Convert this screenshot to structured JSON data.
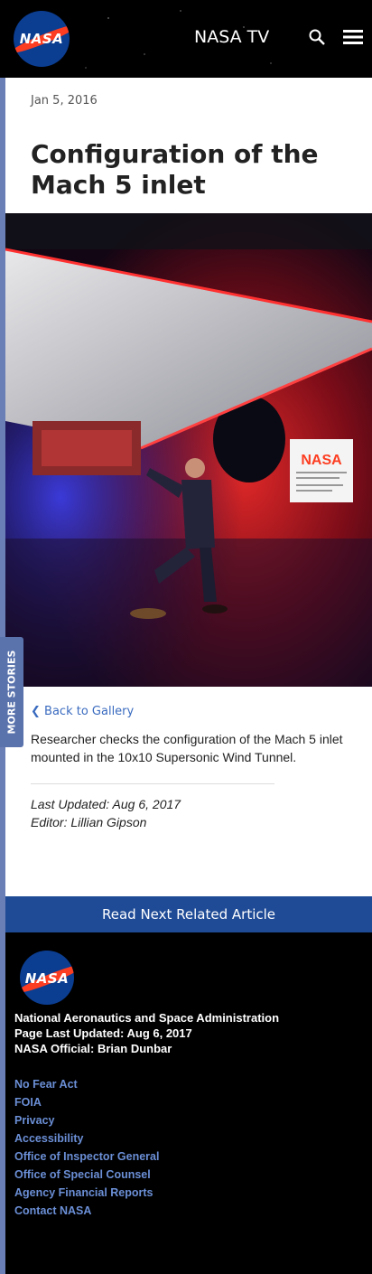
{
  "header": {
    "logo_text": "NASA",
    "nav_label": "NASA TV"
  },
  "sidebar": {
    "more_stories": "MORE STORIES"
  },
  "article": {
    "date": "Jan 5, 2016",
    "title": "Configuration of the Mach 5 inlet",
    "back_link": "Back to Gallery",
    "caption": "Researcher checks the configuration of the Mach 5 inlet mounted in the 10x10 Supersonic Wind Tunnel.",
    "last_updated": "Last Updated: Aug 6, 2017",
    "editor": "Editor: Lillian Gipson"
  },
  "read_next": "Read Next Related Article",
  "footer": {
    "org": "National Aeronautics and Space Administration",
    "page_updated": "Page Last Updated: Aug 6, 2017",
    "official": "NASA Official: Brian Dunbar",
    "links": [
      "No Fear Act",
      "FOIA",
      "Privacy",
      "Accessibility",
      "Office of Inspector General",
      "Office of Special Counsel",
      "Agency Financial Reports",
      "Contact NASA"
    ]
  },
  "colors": {
    "accent_blue": "#1f4b96",
    "link_blue": "#3a6bbf",
    "nasa_red": "#fc3d21",
    "rail": "#6a7fb5"
  }
}
